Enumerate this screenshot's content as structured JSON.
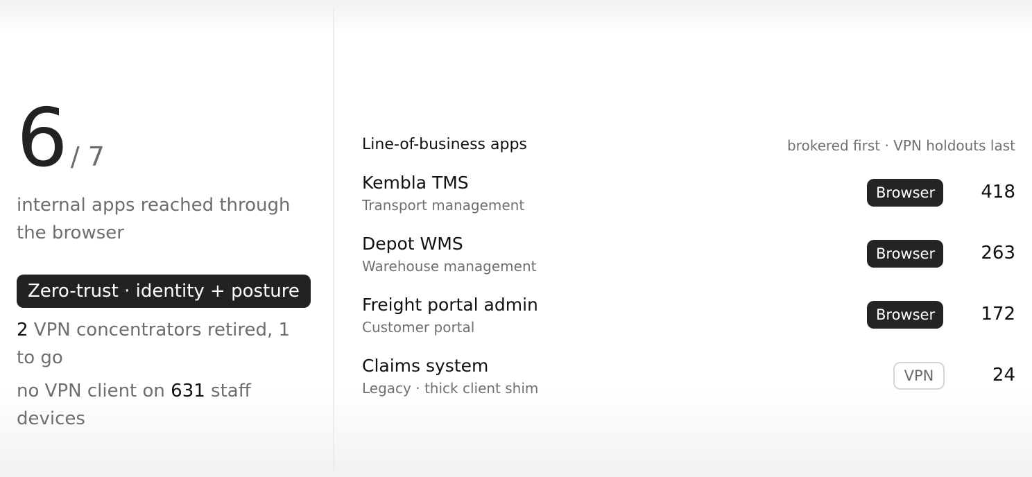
{
  "summary": {
    "big_number": "6",
    "denominator": "/ 7",
    "subtitle": "internal apps reached through the browser",
    "chip": "Zero-trust · identity + posture",
    "stat1": {
      "count": "2",
      "text": " VPN concentrators retired, 1 to go"
    },
    "stat2": {
      "prefix": "no VPN client on ",
      "count": "631",
      "suffix": " staff devices"
    }
  },
  "apps": {
    "title": "Line-of-business apps",
    "note": "brokered first · VPN holdouts last",
    "rows": [
      {
        "name": "Kembla TMS",
        "desc": "Transport management",
        "access": "Browser",
        "count": "418"
      },
      {
        "name": "Depot WMS",
        "desc": "Warehouse management",
        "access": "Browser",
        "count": "263"
      },
      {
        "name": "Freight portal admin",
        "desc": "Customer portal",
        "access": "Browser",
        "count": "172"
      },
      {
        "name": "Claims system",
        "desc": "Legacy · thick client shim",
        "access": "VPN",
        "count": "24"
      }
    ]
  },
  "colors": {
    "dark": "#222222",
    "muted": "#6e6e6e",
    "divider": "#ececec"
  }
}
